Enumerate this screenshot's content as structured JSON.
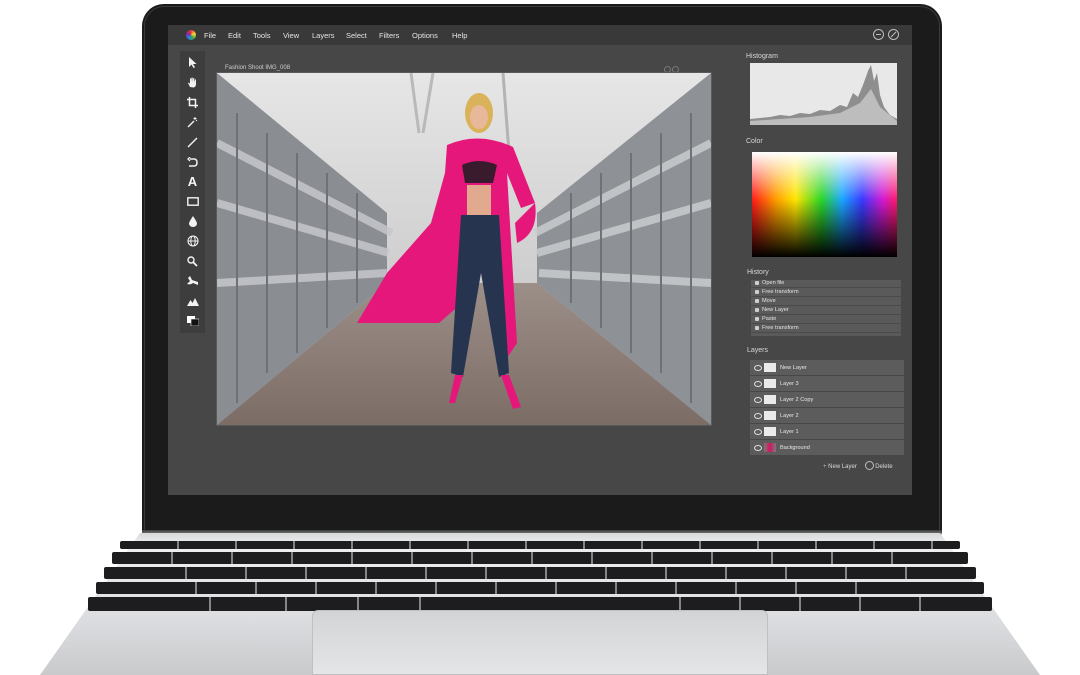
{
  "menubar": {
    "items": [
      "File",
      "Edit",
      "Tools",
      "View",
      "Layers",
      "Select",
      "Filters",
      "Options",
      "Help"
    ]
  },
  "toolbar": {
    "tools": [
      "pointer-icon",
      "hand-icon",
      "crop-icon",
      "magic-wand-icon",
      "line-icon",
      "lasso-icon",
      "text-icon",
      "rectangle-icon",
      "drop-icon",
      "globe-icon",
      "zoom-icon",
      "smudge-icon",
      "mountains-icon",
      "color-swatch-icon"
    ],
    "text_tool_label": "A"
  },
  "document": {
    "title": "Fashion Shoot IMG_008"
  },
  "panels": {
    "histogram_title": "Histogram",
    "color_title": "Color",
    "history_title": "History",
    "layers_title": "Layers"
  },
  "history": {
    "items": [
      "Open file",
      "Free transform",
      "Move",
      "New Layer",
      "Paste",
      "Free transform"
    ]
  },
  "layers": {
    "items": [
      "New Layer",
      "Layer 3",
      "Layer 2 Copy",
      "Layer 2",
      "Layer 1",
      "Background"
    ],
    "new_layer_label": "New Layer",
    "delete_label": "Delete"
  },
  "colors": {
    "accent_pink": "#e6177a",
    "app_bg": "#474747"
  }
}
